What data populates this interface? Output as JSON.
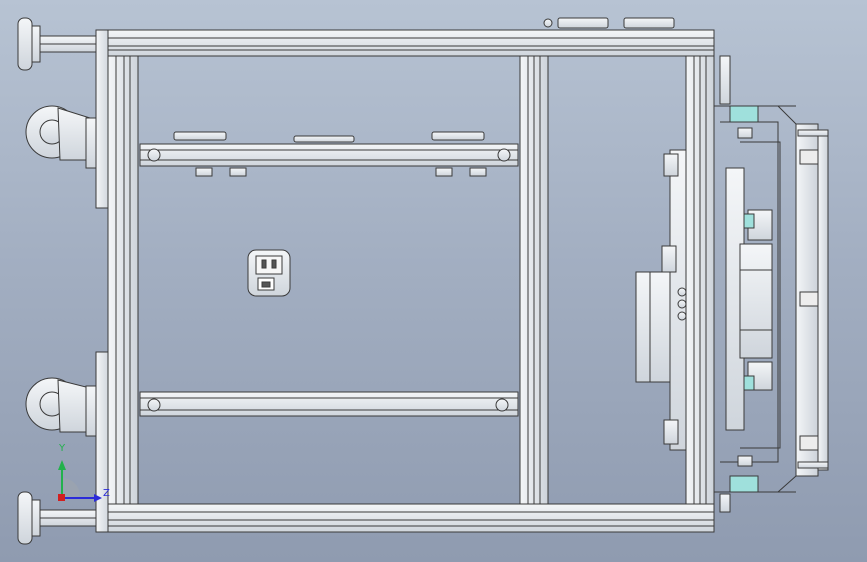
{
  "viewport": {
    "background_top": "#b7c3d3",
    "background_bottom": "#8f9bb0",
    "line_color": "#3a3a3a",
    "part_fill": "#dfe4ea",
    "accent_teal": "#9fe0dc"
  },
  "triad": {
    "y_label": "Y",
    "z_label": "Z",
    "y_color": "#22b14c",
    "z_color": "#2b2bd9",
    "x_color": "#d21f1f"
  }
}
